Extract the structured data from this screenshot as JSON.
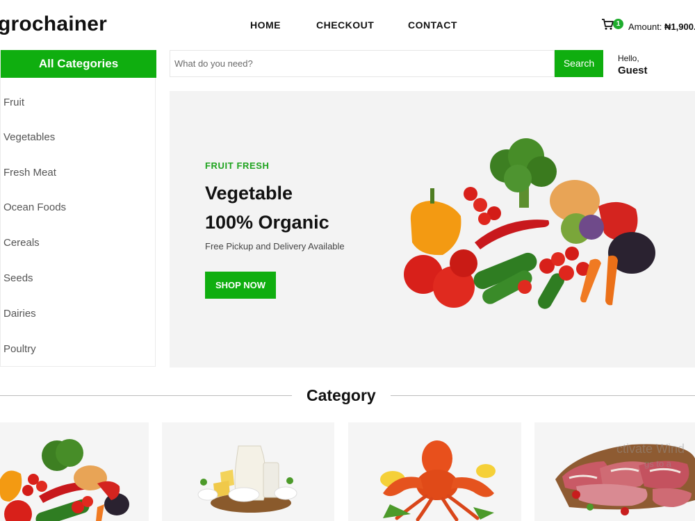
{
  "header": {
    "logo": "grochainer",
    "nav": [
      "HOME",
      "CHECKOUT",
      "CONTACT"
    ],
    "cart_count": "1",
    "amount_label": "Amount:",
    "amount_value": "₦1,900."
  },
  "sidebar": {
    "title": "All Categories",
    "items": [
      "Fruit",
      "Vegetables",
      "Fresh Meat",
      "Ocean Foods",
      "Cereals",
      "Seeds",
      "Dairies",
      "Poultry"
    ]
  },
  "search": {
    "placeholder": "What do you need?",
    "button": "Search"
  },
  "user": {
    "hello": "Hello,",
    "name": "Guest"
  },
  "hero": {
    "tag": "FRUIT FRESH",
    "title_line1": "Vegetable",
    "title_line2": "100% Organic",
    "subtitle": "Free Pickup and Delivery Available",
    "button": "SHOP NOW",
    "image": "vegetables-image"
  },
  "category_section": {
    "title": "Category",
    "cards": [
      "vegetables-image",
      "dairy-image",
      "seafood-image",
      "meat-image"
    ]
  },
  "overlay": {
    "watermark_line1": "ctivate Wind",
    "watermark_line2": "gs to a"
  },
  "colors": {
    "accent": "#0fae0f",
    "hero_bg": "#f3f3f3",
    "tag_green": "#1ea31e"
  }
}
